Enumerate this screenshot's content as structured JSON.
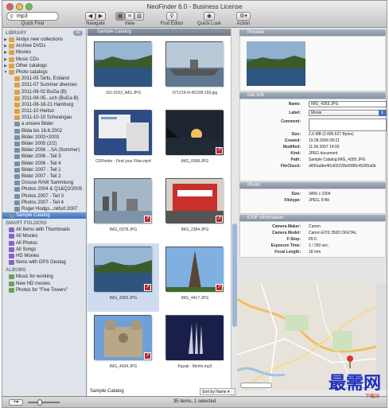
{
  "window": {
    "title": "NeoFinder 6.0 - Business License"
  },
  "toolbar": {
    "search_value": "mp3",
    "quick_find": "Quick Find",
    "navigate": "Navigate",
    "view": "View",
    "find_editor": "Find Editor",
    "quick_look": "Quick Look",
    "action": "Action"
  },
  "sidebar": {
    "library_header": "LIBRARY",
    "library_count": "42",
    "library_items": [
      {
        "label": "Andys new collections",
        "tri": "▶",
        "color": "#d9a44a",
        "indent": 1
      },
      {
        "label": "Archive DVDs",
        "tri": "▶",
        "color": "#d9a44a",
        "indent": 1
      },
      {
        "label": "Movies",
        "tri": "▶",
        "color": "#d9a44a",
        "indent": 1
      },
      {
        "label": "Music CDs",
        "tri": "▶",
        "color": "#d9a44a",
        "indent": 1
      },
      {
        "label": "Other catalogs",
        "tri": "▶",
        "color": "#d9a44a",
        "indent": 1
      },
      {
        "label": "Photo catalogs",
        "tri": "▼",
        "color": "#d9a44a",
        "indent": 1
      },
      {
        "label": "2011-05 Tartu, Estland",
        "tri": "",
        "color": "#e0a040",
        "indent": 2
      },
      {
        "label": "2011-07 Summer diverses",
        "tri": "",
        "color": "#e0a040",
        "indent": 2
      },
      {
        "label": "2011-08-02 BuGa (B)",
        "tri": "",
        "color": "#e0a040",
        "indent": 2
      },
      {
        "label": "2011-08-05...uch (BuGa B)",
        "tri": "",
        "color": "#e0a040",
        "indent": 2
      },
      {
        "label": "2011-08-18-21 Hamburg",
        "tri": "",
        "color": "#e0a040",
        "indent": 2
      },
      {
        "label": "2011-10 Herbst",
        "tri": "",
        "color": "#e0a040",
        "indent": 2
      },
      {
        "label": "2011-10-10 Schwangau",
        "tri": "",
        "color": "#e0a040",
        "indent": 2
      },
      {
        "label": "a unsere Bilder",
        "tri": "",
        "color": "#7a8fa8",
        "indent": 2
      },
      {
        "label": "Bilda bis 16.6.2002",
        "tri": "",
        "color": "#7a8fa8",
        "indent": 2
      },
      {
        "label": "Bilder 2002+2003",
        "tri": "",
        "color": "#7a8fa8",
        "indent": 2
      },
      {
        "label": "Bilder 2005 (2/2)",
        "tri": "",
        "color": "#7a8fa8",
        "indent": 2
      },
      {
        "label": "Bilder 2006 ...SA (Sommer)",
        "tri": "",
        "color": "#7a8fa8",
        "indent": 2
      },
      {
        "label": "Bilder 2006 - Teil 3",
        "tri": "",
        "color": "#7a8fa8",
        "indent": 2
      },
      {
        "label": "Bilder 2006 - Teil 4",
        "tri": "",
        "color": "#7a8fa8",
        "indent": 2
      },
      {
        "label": "Bilder 2007 - Teil 1",
        "tri": "",
        "color": "#7a8fa8",
        "indent": 2
      },
      {
        "label": "Bilder 2007 - Teil 2",
        "tri": "",
        "color": "#7a8fa8",
        "indent": 2
      },
      {
        "label": "Grosse RAW Sammlung",
        "tri": "",
        "color": "#7a8fa8",
        "indent": 2
      },
      {
        "label": "Photos 2004 & Q1&Q2/2005",
        "tri": "",
        "color": "#7a8fa8",
        "indent": 2
      },
      {
        "label": "Photos 2007 - Teil 3",
        "tri": "",
        "color": "#7a8fa8",
        "indent": 2
      },
      {
        "label": "Photos 2007 - Teil 4",
        "tri": "",
        "color": "#7a8fa8",
        "indent": 2
      },
      {
        "label": "Roger Hodgs...nkfurt 2007",
        "tri": "",
        "color": "#7a8fa8",
        "indent": 2
      },
      {
        "label": "Sample Catalog",
        "tri": "",
        "color": "#7a8fa8",
        "indent": 1,
        "selected": true
      }
    ],
    "smart_header": "SMART FOLDERS",
    "smart_items": [
      {
        "label": "All Items with Thumbnails",
        "color": "#8a63c8"
      },
      {
        "label": "All Movies",
        "color": "#8a63c8"
      },
      {
        "label": "All Photos",
        "color": "#8a63c8"
      },
      {
        "label": "All Songs",
        "color": "#8a63c8"
      },
      {
        "label": "HD Movies",
        "color": "#8a63c8"
      },
      {
        "label": "Items with GPS Geotag",
        "color": "#8a63c8"
      }
    ],
    "albums_header": "ALBUMS",
    "album_items": [
      {
        "label": "Music for working",
        "color": "#6fa05a"
      },
      {
        "label": "New HD movies",
        "color": "#6fa05a"
      },
      {
        "label": "Photos for \"Five Towers\"",
        "color": "#6fa05a"
      }
    ]
  },
  "grid": {
    "header": "Sample Catalog",
    "items": [
      {
        "caption": "101-0153_IMG.JPG",
        "thumb": "coast",
        "badge": false
      },
      {
        "caption": "071219-N-4515N-159.jpg",
        "thumb": "ship",
        "badge": false
      },
      {
        "caption": "CDFinder - Find your Files.mp4",
        "thumb": "screen",
        "badge": false
      },
      {
        "caption": "IMG_0098.JPG",
        "thumb": "sunset",
        "badge": true
      },
      {
        "caption": "IMG_0378.JPG",
        "thumb": "city",
        "badge": true
      },
      {
        "caption": "IMG_2384.JPG",
        "thumb": "macworld",
        "badge": true
      },
      {
        "caption": "IMG_4355.JPG",
        "thumb": "coast",
        "badge": true,
        "selected": true
      },
      {
        "caption": "IMG_4417.JPG",
        "thumb": "tower",
        "badge": true
      },
      {
        "caption": "IMG_4434.JPG",
        "thumb": "cathedral",
        "badge": true
      },
      {
        "caption": "Kayak - Merlin.mp3",
        "thumb": "album",
        "badge": false
      }
    ]
  },
  "preview": {
    "header": "Preview"
  },
  "get_info": {
    "header": "Get Info",
    "name_label": "Name:",
    "name_value": "IMG_4355.JPG",
    "label_label": "Label:",
    "label_value": "Movie",
    "comment_label": "Comment:",
    "size_label": "Size:",
    "size_value": "2,6 MB (2.685.627 Bytes)",
    "created_label": "Created:",
    "created_value": "19.08.2006 08:21",
    "modified_label": "Modified:",
    "modified_value": "11.06.2007 14:00",
    "kind_label": "Kind:",
    "kind_value": "JPEG document",
    "path_label": "Path:",
    "path_value": "Sample Catalog:IMG_4355.JPG",
    "filecheck_label": "FileCheck:",
    "filecheck_value": "d430adbe4f1d02228e0088c45265a0b"
  },
  "photo": {
    "header": "Photo",
    "size_label": "Size:",
    "size_value": "3456 x 2304",
    "filetype_label": "Filetype:",
    "filetype_value": "JPEG, 8 Bit"
  },
  "exif": {
    "header": "EXIF Information",
    "rows": [
      {
        "k": "Camera Maker:",
        "v": "Canon"
      },
      {
        "k": "Camera Model:",
        "v": "Canon EOS 350D DIGITAL"
      },
      {
        "k": "F-Stop:",
        "v": "f/9.0"
      },
      {
        "k": "Exposure Time:",
        "v": "1 / 250 sec."
      },
      {
        "k": "Focal Length:",
        "v": "18 mm"
      }
    ]
  },
  "status": {
    "center_text": "35 items, 1 selected",
    "catalog": "Sample Catalog",
    "sort": "Sort by Name",
    "map_search_placeholder": "Search"
  },
  "watermark": {
    "text": "最需网",
    "sub": "下载站"
  }
}
